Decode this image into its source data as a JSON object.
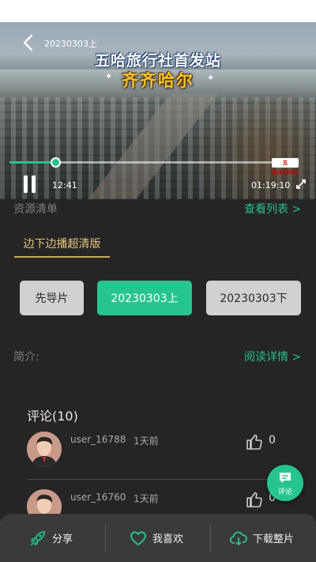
{
  "video": {
    "title": "20230303上",
    "overlay_line1": "五哈旅行社首发站",
    "overlay_line2": "齐齐哈尔",
    "logo_text": "五哈/bilibili",
    "current_time": "12:41",
    "total_time": "01:19:10",
    "progress": 0.173
  },
  "resources": {
    "label": "资源清单",
    "view_list": "查看列表 >",
    "version_tab": "边下边播超清版"
  },
  "episodes": [
    {
      "label": "先导片",
      "active": false
    },
    {
      "label": "20230303上",
      "active": true
    },
    {
      "label": "20230303下",
      "active": false
    }
  ],
  "intro": {
    "label": "简介:",
    "read_more": "阅读详情 >"
  },
  "comments": {
    "title": "评论(10)",
    "items": [
      {
        "user": "user_16788",
        "time": "1天前",
        "likes": "0"
      },
      {
        "user": "user_16760",
        "time": "1天前",
        "likes": "0"
      }
    ]
  },
  "fab": {
    "label": "评论"
  },
  "bottom_bar": {
    "share": "分享",
    "favorite": "我喜欢",
    "download": "下载整片"
  },
  "colors": {
    "accent": "#27c58e",
    "gold": "#e7c77b",
    "background": "#252525"
  }
}
